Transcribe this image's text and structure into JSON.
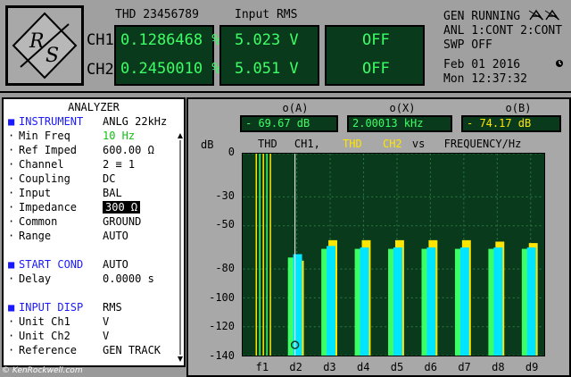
{
  "header": {
    "thd_label": "THD 23456789",
    "rms_label": "Input RMS",
    "ch1": {
      "label": "CH1",
      "thd": "0.1286468 %",
      "rms": "5.023 V",
      "third": "OFF"
    },
    "ch2": {
      "label": "CH2",
      "thd": "0.2450010 %",
      "rms": "5.051 V",
      "third": "OFF"
    },
    "status_line1": "GEN RUNNING",
    "status_line2": "ANL 1:CONT 2:CONT",
    "status_line3": "SWP OFF",
    "date": "Feb 01 2016",
    "time": "Mon 12:37:32"
  },
  "analyzer": {
    "title": "ANALYZER",
    "rows": [
      {
        "bullet": "■",
        "key": "INSTRUMENT",
        "value": "ANLG  22kHz"
      },
      {
        "bullet": "·",
        "key": "Min Freq",
        "value": "10 Hz"
      },
      {
        "bullet": "·",
        "key": "Ref Imped",
        "value": "600.00 Ω"
      },
      {
        "bullet": "·",
        "key": "Channel",
        "value": "2 ≡ 1"
      },
      {
        "bullet": "·",
        "key": "Coupling",
        "value": "DC"
      },
      {
        "bullet": "·",
        "key": "Input",
        "value": "BAL"
      },
      {
        "bullet": "·",
        "key": "Impedance",
        "value": "300 Ω"
      },
      {
        "bullet": "·",
        "key": "Common",
        "value": "GROUND"
      },
      {
        "bullet": "·",
        "key": "Range",
        "value": "AUTO"
      },
      {
        "bullet": "■",
        "key": "START COND",
        "value": "AUTO"
      },
      {
        "bullet": "·",
        "key": "Delay",
        "value": "0.0000 s"
      },
      {
        "bullet": "■",
        "key": "INPUT DISP",
        "value": "RMS"
      },
      {
        "bullet": "·",
        "key": "Unit Ch1",
        "value": "V"
      },
      {
        "bullet": "·",
        "key": "Unit Ch2",
        "value": "V"
      },
      {
        "bullet": "·",
        "key": "Reference",
        "value": "GEN TRACK"
      }
    ]
  },
  "graph": {
    "marker_a_label": "o(A)",
    "marker_x_label": "o(X)",
    "marker_b_label": "o(B)",
    "marker_a_value": "- 69.67 dB",
    "marker_x_value": "2.00013 kHz",
    "marker_b_value": "- 74.17 dB",
    "y_unit": "dB",
    "legend_thd": "THD",
    "legend_ch1": "CH1,",
    "legend_thd2": "THD",
    "legend_ch2": "CH2",
    "legend_vs": "vs",
    "legend_freq": "FREQUENCY/Hz"
  },
  "chart_data": {
    "type": "bar",
    "categories": [
      "f1",
      "d2",
      "d3",
      "d4",
      "d5",
      "d6",
      "d7",
      "d8",
      "d9"
    ],
    "ylabel": "dB",
    "ylim": [
      -140,
      0
    ],
    "yticks": [
      "0",
      "-30",
      "-50",
      "-80",
      "-100",
      "-120",
      "-140"
    ],
    "series": [
      {
        "name": "CH1",
        "color": "#00e5ff",
        "values": [
          0,
          -69.67,
          -64,
          -65,
          -65,
          -65,
          -65,
          -65,
          -65
        ]
      },
      {
        "name": "CH2",
        "color": "#ffe600",
        "values": [
          0,
          -74.17,
          -60,
          -60,
          -60,
          -60,
          -60,
          -61,
          -62
        ]
      },
      {
        "color": "#3cff66",
        "values": [
          0,
          -72,
          -66,
          -66,
          -66,
          -66,
          -66,
          -66,
          -66
        ]
      }
    ],
    "colors": {
      "ch1_thd": "#ffffff",
      "ch2_thd": "#ffe600",
      "green": "#3cff66"
    }
  },
  "credit": "© KenRockwell.com"
}
